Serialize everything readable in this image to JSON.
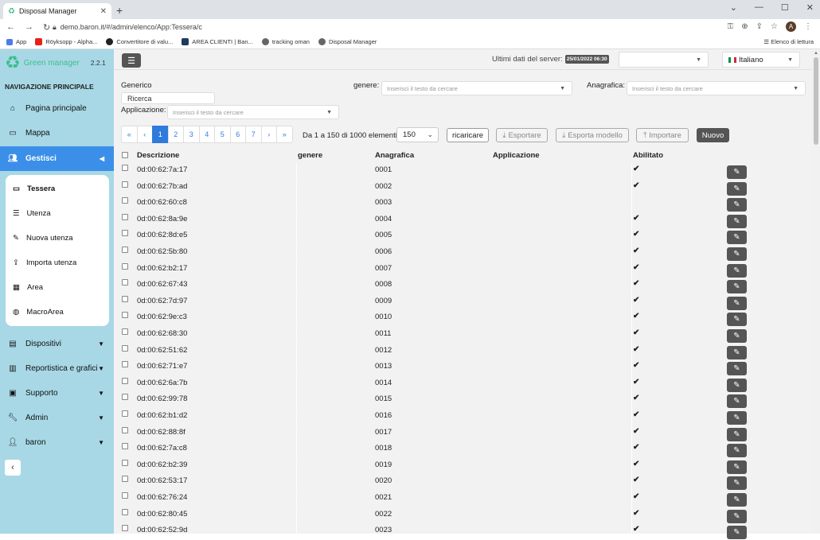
{
  "browser": {
    "tab_title": "Disposal Manager",
    "url": "demo.baron.it/#/admin/elenco/App:Tessera/c",
    "bookmarks": [
      "App",
      "Röyksopp - Alpha...",
      "Convertitore di valu...",
      "AREA CLIENTI | Ban...",
      "tracking oman",
      "Disposal Manager"
    ],
    "reading_list": "Elenco di lettura",
    "avatar_letter": "A"
  },
  "sidebar": {
    "brand": "Green manager",
    "version": "2.2.1",
    "nav_heading": "NAVIGAZIONE PRINCIPALE",
    "items": [
      {
        "label": "Pagina principale",
        "icon": "home-icon"
      },
      {
        "label": "Mappa",
        "icon": "map-icon"
      },
      {
        "label": "Gestisci",
        "icon": "users-icon",
        "active": true
      },
      {
        "label": "Dispositivi",
        "icon": "box-icon"
      },
      {
        "label": "Reportistica e grafici",
        "icon": "chart-icon"
      },
      {
        "label": "Supporto",
        "icon": "inbox-icon"
      },
      {
        "label": "Admin",
        "icon": "wrench-icon"
      },
      {
        "label": "baron",
        "icon": "user-icon"
      }
    ],
    "submenu": [
      {
        "label": "Tessera",
        "icon": "card-icon",
        "active": true
      },
      {
        "label": "Utenza",
        "icon": "list-icon"
      },
      {
        "label": "Nuova utenza",
        "icon": "pencil-icon"
      },
      {
        "label": "Importa utenza",
        "icon": "upload-icon"
      },
      {
        "label": "Area",
        "icon": "map-fold-icon"
      },
      {
        "label": "MacroArea",
        "icon": "globe-icon"
      }
    ]
  },
  "topbar": {
    "server_label": "Ultimi dati del server:",
    "server_date": "25/01/2022 06:30",
    "language": "Italiano"
  },
  "filters": {
    "generico_label": "Generico",
    "ricerca_value": "Ricerca",
    "genere_label": "genere:",
    "genere_placeholder": "Inserisci il testo da cercare",
    "anagrafica_label": "Anagrafica:",
    "anagrafica_placeholder": "Inserisci il testo da cercare",
    "applicazione_label": "Applicazione:",
    "applicazione_placeholder": "Inserisci il testo da cercare"
  },
  "pager": {
    "first": "«",
    "prev": "‹",
    "pages": [
      "1",
      "2",
      "3",
      "4",
      "5",
      "6",
      "7"
    ],
    "next": "›",
    "last": "»",
    "range_text": "Da 1 a 150 di 1000 elementi",
    "per_page": "150"
  },
  "toolbar": {
    "reload": "ricaricare",
    "export": "Esportare",
    "export_model": "Esporta modello",
    "import": "Importare",
    "new": "Nuovo"
  },
  "table": {
    "headers": {
      "descrizione": "Descrizione",
      "genere": "genere",
      "anagrafica": "Anagrafica",
      "applicazione": "Applicazione",
      "abilitato": "Abilitato"
    },
    "rows": [
      {
        "desc": "0d:00:62:7a:17",
        "anag": "0001",
        "enabled": true
      },
      {
        "desc": "0d:00:62:7b:ad",
        "anag": "0002",
        "enabled": true
      },
      {
        "desc": "0d:00:62:60:c8",
        "anag": "0003",
        "enabled": false
      },
      {
        "desc": "0d:00:62:8a:9e",
        "anag": "0004",
        "enabled": true
      },
      {
        "desc": "0d:00:62:8d:e5",
        "anag": "0005",
        "enabled": true
      },
      {
        "desc": "0d:00:62:5b:80",
        "anag": "0006",
        "enabled": true
      },
      {
        "desc": "0d:00:62:b2:17",
        "anag": "0007",
        "enabled": true
      },
      {
        "desc": "0d:00:62:67:43",
        "anag": "0008",
        "enabled": true
      },
      {
        "desc": "0d:00:62:7d:97",
        "anag": "0009",
        "enabled": true
      },
      {
        "desc": "0d:00:62:9e:c3",
        "anag": "0010",
        "enabled": true
      },
      {
        "desc": "0d:00:62:68:30",
        "anag": "0011",
        "enabled": true
      },
      {
        "desc": "0d:00:62:51:62",
        "anag": "0012",
        "enabled": true
      },
      {
        "desc": "0d:00:62:71:e7",
        "anag": "0013",
        "enabled": true
      },
      {
        "desc": "0d:00:62:6a:7b",
        "anag": "0014",
        "enabled": true
      },
      {
        "desc": "0d:00:62:99:78",
        "anag": "0015",
        "enabled": true
      },
      {
        "desc": "0d:00:62:b1:d2",
        "anag": "0016",
        "enabled": true
      },
      {
        "desc": "0d:00:62:88:8f",
        "anag": "0017",
        "enabled": true
      },
      {
        "desc": "0d:00:62:7a:c8",
        "anag": "0018",
        "enabled": true
      },
      {
        "desc": "0d:00:62:b2:39",
        "anag": "0019",
        "enabled": true
      },
      {
        "desc": "0d:00:62:53:17",
        "anag": "0020",
        "enabled": true
      },
      {
        "desc": "0d:00:62:76:24",
        "anag": "0021",
        "enabled": true
      },
      {
        "desc": "0d:00:62:80:45",
        "anag": "0022",
        "enabled": true
      },
      {
        "desc": "0d:00:62:52:9d",
        "anag": "0023",
        "enabled": true
      }
    ]
  },
  "colors": {
    "accent": "#3b8fe8",
    "sidebar": "#a8d8e6",
    "brand": "#3bbf8a",
    "dark_button": "#555555"
  }
}
